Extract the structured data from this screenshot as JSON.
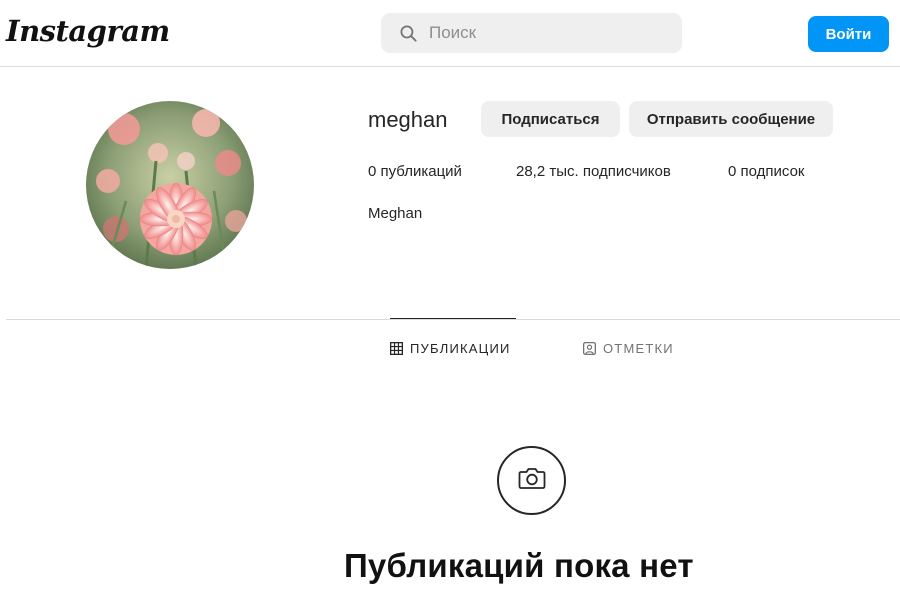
{
  "header": {
    "logo": "Instagram",
    "search_placeholder": "Поиск",
    "login_label": "Войти"
  },
  "profile": {
    "username": "meghan",
    "follow_label": "Подписаться",
    "message_label": "Отправить сообщение",
    "stats": {
      "posts": "0 публикаций",
      "followers": "28,2 тыс. подписчиков",
      "following": "0 подписок"
    },
    "full_name": "Meghan"
  },
  "tabs": [
    {
      "label": "ПУБЛИКАЦИИ",
      "icon": "grid-icon",
      "active": true
    },
    {
      "label": "ОТМЕТКИ",
      "icon": "tagged-user-icon",
      "active": false
    }
  ],
  "empty_state": {
    "icon": "camera-icon",
    "title": "Публикаций пока нет"
  },
  "colors": {
    "accent": "#0095f6",
    "button_gray": "#efefef",
    "divider": "#dbdbdb"
  }
}
